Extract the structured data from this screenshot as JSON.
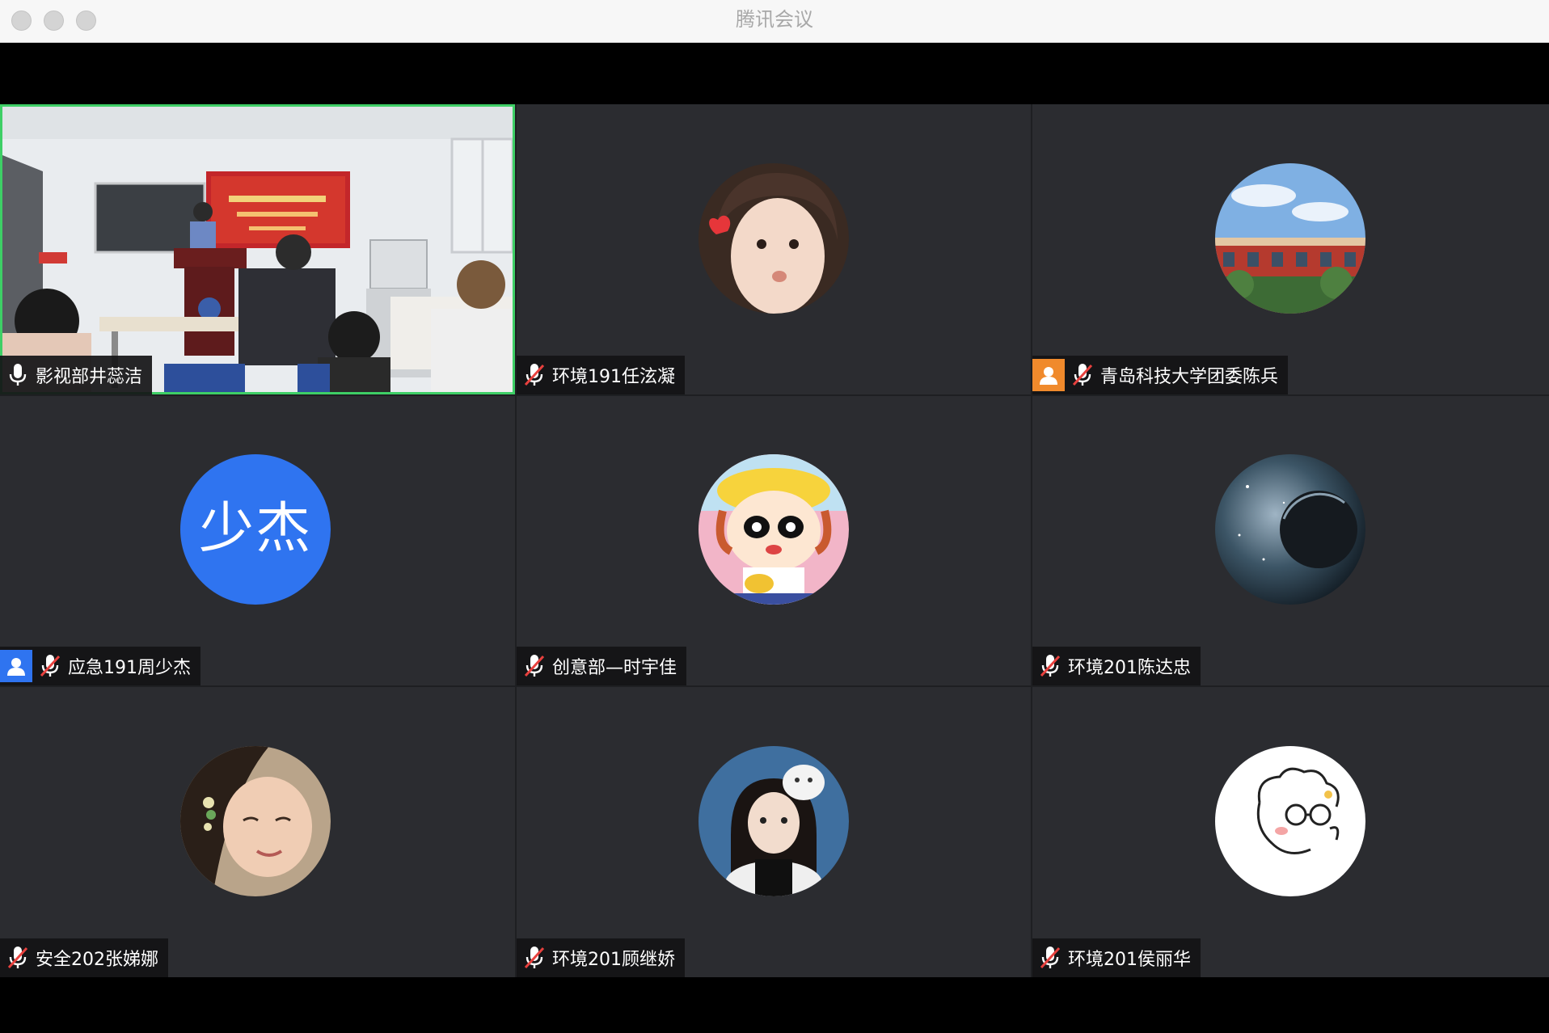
{
  "window": {
    "title": "腾讯会议"
  },
  "colors": {
    "active_speaker_border": "#3ecf66",
    "tile_bg": "#2b2c30",
    "initials_avatar": "#2f74f0",
    "host_badge": "#f08a2c"
  },
  "participants": [
    {
      "name": "影视部井蕊洁",
      "mic": "unmuted",
      "video": "on",
      "active": true
    },
    {
      "name": "环境191任泫凝",
      "mic": "muted",
      "video": "off",
      "avatar": "girl-photo"
    },
    {
      "name": "青岛科技大学团委陈兵",
      "mic": "muted",
      "video": "off",
      "avatar": "building-photo",
      "badge": "host"
    },
    {
      "name": "应急191周少杰",
      "mic": "muted",
      "video": "off",
      "initials": "少杰",
      "badge": "user"
    },
    {
      "name": "创意部—时宇佳",
      "mic": "muted",
      "video": "off",
      "avatar": "cartoon-girl"
    },
    {
      "name": "环境201陈达忠",
      "mic": "muted",
      "video": "off",
      "avatar": "planet"
    },
    {
      "name": "安全202张娣娜",
      "mic": "muted",
      "video": "off",
      "avatar": "woman-photo"
    },
    {
      "name": "环境201顾继娇",
      "mic": "muted",
      "video": "off",
      "avatar": "girl-with-cat"
    },
    {
      "name": "环境201侯丽华",
      "mic": "muted",
      "video": "off",
      "avatar": "doodle-face"
    }
  ]
}
